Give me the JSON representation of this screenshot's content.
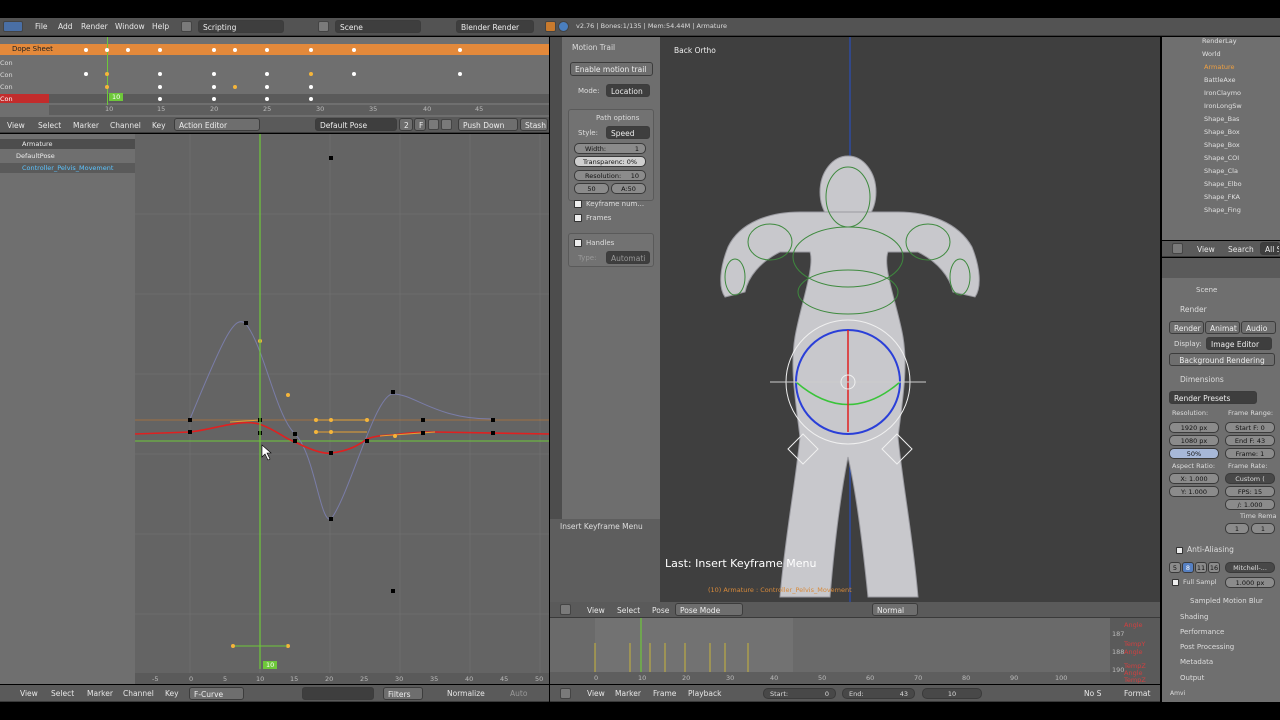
{
  "topbar": {
    "menus": [
      "File",
      "Add",
      "Render",
      "Window",
      "Help"
    ],
    "screen_layout": "Scripting",
    "scene": "Scene",
    "engine": "Blender Render",
    "info": "v2.76 | Bones:1/135 | Mem:54.44M | Armature"
  },
  "dopesheet": {
    "summary": "Dope Sheet",
    "channel_rows": [
      "Con",
      "Con",
      "Con",
      "Con"
    ],
    "current_frame": "10",
    "ruler_ticks": [
      "10",
      "15",
      "20",
      "25",
      "30",
      "35",
      "40",
      "45"
    ],
    "header": {
      "menus": [
        "View",
        "Select",
        "Marker",
        "Channel",
        "Key"
      ],
      "mode": "Action Editor",
      "action": "Default Pose",
      "users": "2",
      "f_label": "F",
      "push_down": "Push Down",
      "stash": "Stash"
    }
  },
  "graph": {
    "channels": [
      "Armature",
      "DefaultPose",
      "Controller_Pelvis_Movement"
    ],
    "current_frame": "10",
    "x_ticks": [
      "-5",
      "0",
      "5",
      "10",
      "15",
      "20",
      "25",
      "30",
      "35",
      "40",
      "45",
      "50"
    ],
    "header": {
      "menus": [
        "View",
        "Select",
        "Marker",
        "Channel",
        "Key"
      ],
      "mode": "F-Curve",
      "filters": "Filters",
      "normalize": "Normalize",
      "auto": "Auto"
    }
  },
  "toolshelf": {
    "tabs": [
      "Tools",
      "Options",
      "Grease Pencil",
      "Animation"
    ],
    "panel_title": "Motion Trail",
    "enable_btn": "Enable motion trail",
    "mode_label": "Mode:",
    "mode_value": "Location",
    "path_options": "Path options",
    "style_label": "Style:",
    "style_value": "Speed",
    "width_label": "Width:",
    "width_value": "1",
    "transparency": "Transparenc: 0%",
    "resolution_label": "Resolution:",
    "resolution_value": "10",
    "before": "50",
    "after": "A:50",
    "keyframe_numbers": "Keyframe num...",
    "frames": "Frames",
    "handles": "Handles",
    "type_label": "Type:",
    "type_value": "Automati",
    "operator_title": "Insert Keyframe Menu"
  },
  "viewport": {
    "view_label": "Back Ortho",
    "last_op": "Last: Insert Keyframe Menu",
    "object_info": "(10) Armature : Controller_Pelvis_Movement",
    "header": {
      "menus": [
        "View",
        "Select",
        "Pose"
      ],
      "mode": "Pose Mode",
      "orientation": "Normal"
    }
  },
  "timeline": {
    "ticks": [
      "0",
      "10",
      "20",
      "30",
      "40",
      "50",
      "60",
      "70",
      "80",
      "90",
      "100"
    ],
    "channel_labels": [
      "Angle",
      "TempY",
      "Angle",
      "TempZ",
      "Angle",
      "TempZ"
    ],
    "side_ticks": [
      "187",
      "188",
      "190"
    ],
    "header": {
      "menus": [
        "View",
        "Marker",
        "Frame",
        "Playback"
      ],
      "start_label": "Start:",
      "start_value": "0",
      "end_label": "End:",
      "end_value": "43",
      "current": "10",
      "nosync": "No S",
      "format": "Format"
    }
  },
  "outliner": {
    "items": [
      "RenderLay",
      "World",
      "Armature",
      "BattleAxe",
      "IronClaymo",
      "IronLongSw",
      "Shape_Bas",
      "Shape_Box",
      "Shape_Box",
      "Shape_COI",
      "Shape_Cla",
      "Shape_Elbo",
      "Shape_FKA",
      "Shape_Fing"
    ],
    "header": {
      "view": "View",
      "search": "Search",
      "all": "All S"
    }
  },
  "properties": {
    "scene": "Scene",
    "render_panel": "Render",
    "render_btn": "Render",
    "anim_btn": "Animat",
    "audio_btn": "Audio",
    "display_label": "Display:",
    "display_value": "Image Editor",
    "background_render": "Background Rendering",
    "dimensions": "Dimensions",
    "render_presets": "Render Presets",
    "resolution": "Resolution:",
    "res_x": "1920 px",
    "res_y": "1080 px",
    "res_pct": "50%",
    "frame_range": "Frame Range:",
    "start_f": "Start F: 0",
    "end_f": "End F: 43",
    "frame_step": "Frame: 1",
    "aspect": "Aspect Ratio:",
    "asp_x": "X: 1.000",
    "asp_y": "Y: 1.000",
    "frame_rate": "Frame Rate:",
    "custom": "Custom (",
    "fps": "FPS: 15",
    "base": "/: 1.000",
    "time_remap": "Time Rema",
    "remap_old": "1",
    "remap_new": "1",
    "anti_alias": "Anti-Aliasing",
    "aa_samples": [
      "5",
      "8",
      "11",
      "16"
    ],
    "aa_filter": "Mitchell-...",
    "full_sample": "Full Sampl",
    "filter_size": "1.000 px",
    "motion_blur": "Sampled Motion Blur",
    "shading": "Shading",
    "performance": "Performance",
    "post_processing": "Post Processing",
    "metadata": "Metadata",
    "output": "Output",
    "footer": "Amvi"
  },
  "colors": {
    "accent_orange": "#f08a1c",
    "curve_red": "#e02020",
    "frame_green": "#6ec83a",
    "header_gray": "#5a5a5a",
    "panel_gray": "#6e6e6e"
  }
}
